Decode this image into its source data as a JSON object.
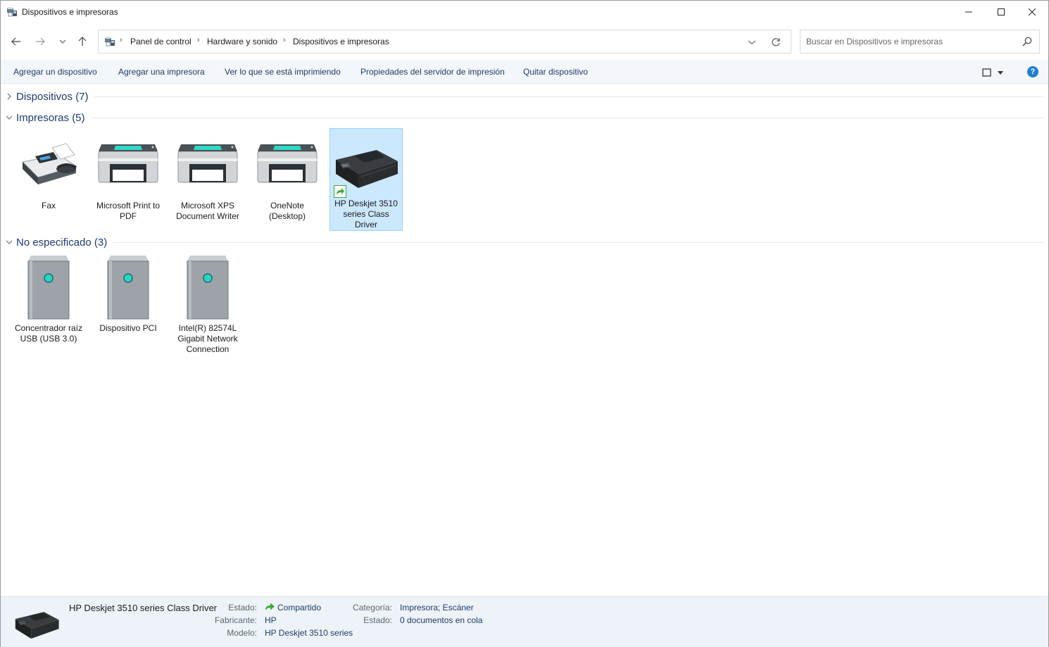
{
  "window": {
    "title": "Dispositivos e impresoras",
    "icon": "devices-printers-icon"
  },
  "nav": {
    "breadcrumbs": [
      "Panel de control",
      "Hardware y sonido",
      "Dispositivos e impresoras"
    ],
    "search_placeholder": "Buscar en Dispositivos e impresoras"
  },
  "commands": [
    "Agregar un dispositivo",
    "Agregar una impresora",
    "Ver lo que se está imprimiendo",
    "Propiedades del servidor de impresión",
    "Quitar dispositivo"
  ],
  "groups": {
    "dispositivos": {
      "title": "Dispositivos (7)",
      "expanded": false
    },
    "impresoras": {
      "title": "Impresoras (5)",
      "expanded": true,
      "items": [
        {
          "label": "Fax",
          "icon": "fax-icon"
        },
        {
          "label": "Microsoft Print to PDF",
          "icon": "printer-icon"
        },
        {
          "label": "Microsoft XPS Document Writer",
          "icon": "printer-icon"
        },
        {
          "label": "OneNote (Desktop)",
          "icon": "printer-icon"
        },
        {
          "label": "HP Deskjet 3510 series Class Driver",
          "icon": "hp-printer-icon",
          "shared": true,
          "selected": true
        }
      ]
    },
    "no_especificado": {
      "title": "No especificado (3)",
      "expanded": true,
      "items": [
        {
          "label": "Concentrador raíz USB (USB 3.0)",
          "icon": "tower-device-icon"
        },
        {
          "label": "Dispositivo PCI",
          "icon": "tower-device-icon"
        },
        {
          "label": "Intel(R) 82574L Gigabit Network Connection",
          "icon": "tower-device-icon"
        }
      ]
    }
  },
  "details": {
    "name": "HP Deskjet 3510 series Class Driver",
    "estado_label": "Estado:",
    "estado_value": "Compartido",
    "fabricante_label": "Fabricante:",
    "fabricante_value": "HP",
    "modelo_label": "Modelo:",
    "modelo_value": "HP Deskjet 3510 series",
    "categoria_label": "Categoría:",
    "categoria_value": "Impresora; Escáner",
    "estado2_label": "Estado:",
    "estado2_value": "0 documentos en cola"
  },
  "colors": {
    "link_blue": "#1e3a6b",
    "selection": "#cce8ff",
    "accent_teal": "#2ad4c8"
  }
}
